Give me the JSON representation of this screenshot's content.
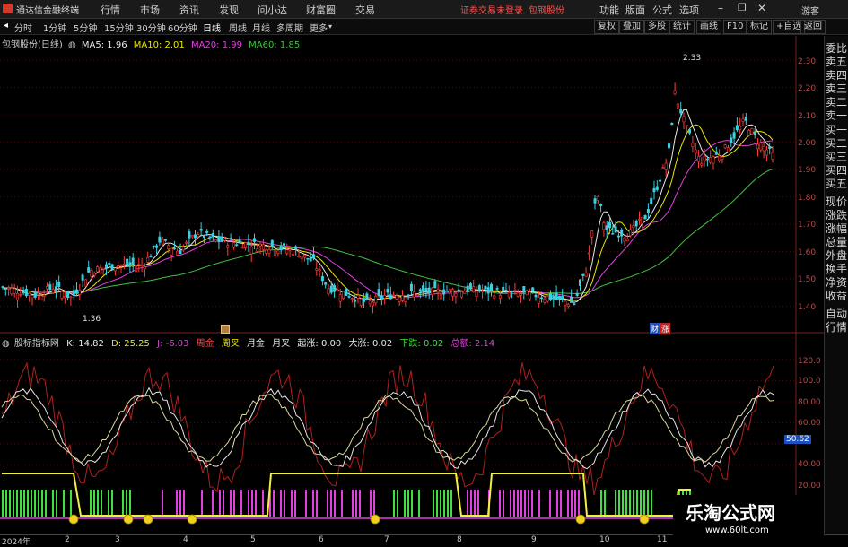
{
  "titlebar": {
    "app_title": "通达信金融终端",
    "menu": [
      "行情",
      "市场",
      "资讯",
      "发现",
      "问小达",
      "财富圈",
      "交易"
    ],
    "warning": "证券交易未登录",
    "stock": "包钢股份",
    "right": [
      "功能",
      "版面",
      "公式",
      "选项"
    ],
    "guest": "游客"
  },
  "toolbar": {
    "periods": [
      "分时",
      "1分钟",
      "5分钟",
      "15分钟",
      "30分钟",
      "60分钟",
      "日线",
      "周线",
      "月线",
      "多周期",
      "更多"
    ],
    "active_period": "日线",
    "right_buttons": [
      "复权",
      "叠加",
      "多股",
      "统计",
      "画线",
      "F10",
      "标记",
      "+自选",
      "返回"
    ]
  },
  "main_chart": {
    "title": "包钢股份(日线)",
    "ma_legend": [
      {
        "label": "MA5: 1.96",
        "color": "#e8e8e8"
      },
      {
        "label": "MA10: 2.01",
        "color": "#e8e800"
      },
      {
        "label": "MA20: 1.99",
        "color": "#e040e0"
      },
      {
        "label": "MA60: 1.85",
        "color": "#40c040"
      }
    ],
    "y_labels": [
      "2.30",
      "2.20",
      "2.10",
      "2.00",
      "1.90",
      "1.80",
      "1.70",
      "1.60",
      "1.50",
      "1.40"
    ],
    "high_label": "2.33",
    "low_label": "1.36",
    "event_badges": [
      "财",
      "涨"
    ]
  },
  "indicator": {
    "name": "股标指标网",
    "values": [
      {
        "label": "K: 14.82",
        "color": "#e8e8e8"
      },
      {
        "label": "D: 25.25",
        "color": "#e8e800"
      },
      {
        "label": "J: -6.03",
        "color": "#e040e0"
      },
      {
        "label": "周金",
        "color": "#ff4040"
      },
      {
        "label": "周叉",
        "color": "#e8e800"
      },
      {
        "label": "月金",
        "color": "#e8e8e8"
      },
      {
        "label": "月叉",
        "color": "#e8e8e8"
      },
      {
        "label": "起涨: 0.00",
        "color": "#e8e8e8"
      },
      {
        "label": "大涨: 0.02",
        "color": "#e8e8e8"
      },
      {
        "label": "下跌: 0.02",
        "color": "#40e040"
      },
      {
        "label": "总额: 2.14",
        "color": "#e040e0"
      }
    ],
    "y_labels": [
      "120.0",
      "100.0",
      "80.00",
      "60.00",
      "40.00",
      "20.00"
    ],
    "current_value": "50.62"
  },
  "x_axis": [
    "2024年",
    "2",
    "3",
    "4",
    "5",
    "6",
    "7",
    "8",
    "9",
    "10",
    "11"
  ],
  "right_panel": [
    "委比",
    "卖五",
    "卖四",
    "卖三",
    "卖二",
    "卖一",
    "买一",
    "买二",
    "买三",
    "买四",
    "买五",
    "现价",
    "涨跌",
    "涨幅",
    "总量",
    "外盘",
    "换手",
    "净资",
    "收益",
    "自动",
    "行情"
  ],
  "watermark": {
    "name": "乐淘公式网",
    "url": "www.60lt.com"
  }
}
